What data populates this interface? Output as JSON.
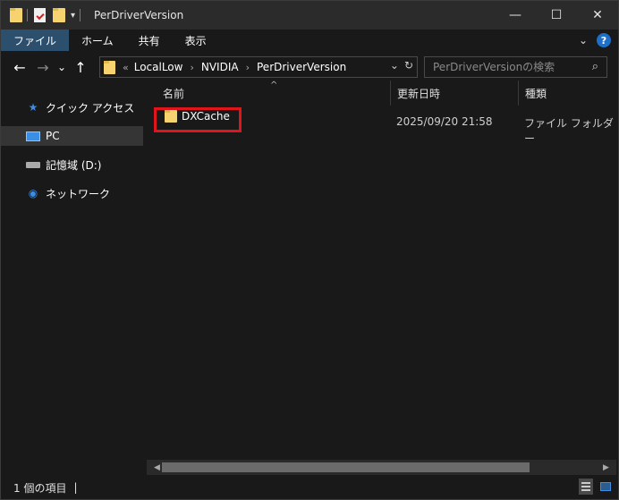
{
  "window": {
    "title": "PerDriverVersion"
  },
  "titlebar": {
    "minimize_glyph": "—",
    "maximize_glyph": "☐",
    "close_glyph": "✕",
    "quick_access_dropdown": "▾"
  },
  "ribbon": {
    "tabs": [
      {
        "label": "ファイル",
        "active": true
      },
      {
        "label": "ホーム"
      },
      {
        "label": "共有"
      },
      {
        "label": "表示"
      }
    ],
    "expand_glyph": "⌄",
    "help_glyph": "?"
  },
  "navigation": {
    "back_glyph": "←",
    "forward_glyph": "→",
    "recent_glyph": "⌄",
    "up_glyph": "↑",
    "overflow_glyph": "«",
    "breadcrumb": [
      "LocalLow",
      "NVIDIA",
      "PerDriverVersion"
    ],
    "separator_glyph": "›",
    "dropdown_glyph": "⌄",
    "refresh_glyph": "↻"
  },
  "search": {
    "placeholder": "PerDriverVersionの検索",
    "icon": "search-icon",
    "icon_glyph": "⌕"
  },
  "sidebar": {
    "items": [
      {
        "label": "クイック アクセス",
        "icon": "star-icon",
        "icon_glyph": "★"
      },
      {
        "label": "PC",
        "icon": "pc-icon",
        "selected": true
      },
      {
        "label": "記憶域 (D:)",
        "icon": "drive-icon"
      },
      {
        "label": "ネットワーク",
        "icon": "network-icon",
        "icon_glyph": "◉"
      }
    ]
  },
  "list": {
    "sort_indicator": "^",
    "columns": [
      "名前",
      "更新日時",
      "種類"
    ],
    "rows": [
      {
        "name": "DXCache",
        "modified": "2025/09/20 21:58",
        "type": "ファイル フォルダー",
        "highlighted": true
      }
    ]
  },
  "scrollbar": {
    "left_glyph": "◀",
    "right_glyph": "▶"
  },
  "status": {
    "item_count": "1 個の項目",
    "caret": "|"
  },
  "colors": {
    "background": "#191919",
    "titlebar": "#2b2b2b",
    "active_tab": "#2d4f6e",
    "selected_nav": "#353535",
    "highlight_border": "#e0151b",
    "folder": "#f6d36e",
    "accent": "#3a8ee6"
  }
}
